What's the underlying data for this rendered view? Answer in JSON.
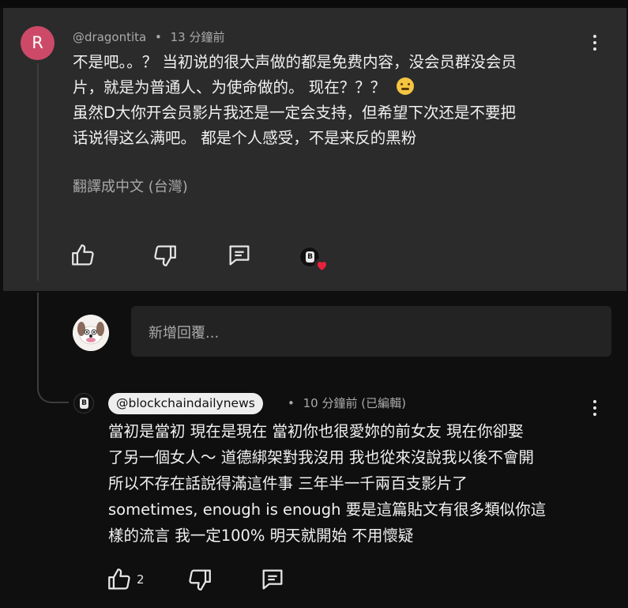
{
  "comment": {
    "avatar_letter": "R",
    "avatar_color": "#cc4a68",
    "author": "@dragontita",
    "separator": "•",
    "time": "13 分鐘前",
    "lines": [
      "不是吧。。？  当初说的很大声做的都是免费内容，没会员群没会员",
      "片，就是为普通人、为使命做的。  现在？？？",
      "虽然D大你开会员影片我还是一定会支持，但希望下次还是不要把",
      "话说得这么满吧。  都是个人感受，不是来反的黑粉"
    ],
    "emoji": "zipper-mouth-face",
    "translate_label": "翻譯成中文 (台灣)",
    "actions": [
      "like-icon",
      "dislike-icon",
      "reply-icon",
      "creator-heart-icon"
    ]
  },
  "reply_input": {
    "placeholder": "新增回覆..."
  },
  "reply": {
    "author": "@blockchaindailynews",
    "separator": "•",
    "time": "10 分鐘前 (已編輯)",
    "lines": [
      "當初是當初 現在是現在 當初你也很愛妳的前女友 現在你卻娶",
      "了另一個女人～ 道德綁架對我沒用 我也從來沒說我以後不會開",
      "所以不存在話說得滿這件事 三年半一千兩百支影片了",
      "sometimes, enough is enough 要是這篇貼文有很多類似你這",
      "樣的流言 我一定100% 明天就開始 不用懷疑"
    ],
    "like_count": "2",
    "actions": [
      "like-icon",
      "dislike-icon",
      "reply-icon"
    ]
  },
  "colors": {
    "comment_bg": "#2b2b2b",
    "page_bg": "#0f0f0f",
    "text": "#f1f1f1",
    "muted": "#aaaaaa",
    "heart": "#e8213a"
  }
}
